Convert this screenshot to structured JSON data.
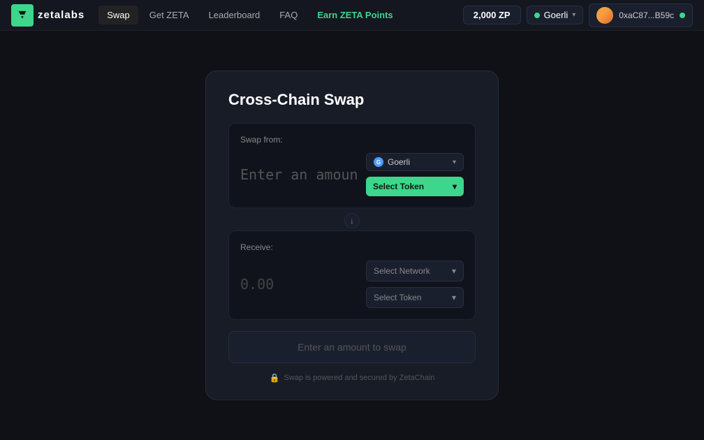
{
  "nav": {
    "logo_text": "zetalabs",
    "links": [
      {
        "label": "Swap",
        "active": true,
        "highlight": false
      },
      {
        "label": "Get ZETA",
        "active": false,
        "highlight": false
      },
      {
        "label": "Leaderboard",
        "active": false,
        "highlight": false
      },
      {
        "label": "FAQ",
        "active": false,
        "highlight": false
      },
      {
        "label": "Earn ZETA Points",
        "active": false,
        "highlight": true
      }
    ],
    "zp_balance": "2,000 ZP",
    "network": "Goerli",
    "wallet_address": "0xaC87...B59c"
  },
  "swap": {
    "title": "Cross-Chain Swap",
    "from_label": "Swap from:",
    "amount_placeholder": "Enter an amount",
    "from_network": "Goerli",
    "from_token": "Select Token",
    "arrow": "↓",
    "receive_label": "Receive:",
    "receive_amount": "0.00",
    "receive_network_placeholder": "Select Network",
    "receive_token_placeholder": "Select Token",
    "action_btn": "Enter an amount to swap",
    "footer_text": "Swap is powered and secured by ZetaChain"
  },
  "icons": {
    "chevron_down": "▾",
    "lock": "🔒",
    "arrow_down": "↓"
  }
}
